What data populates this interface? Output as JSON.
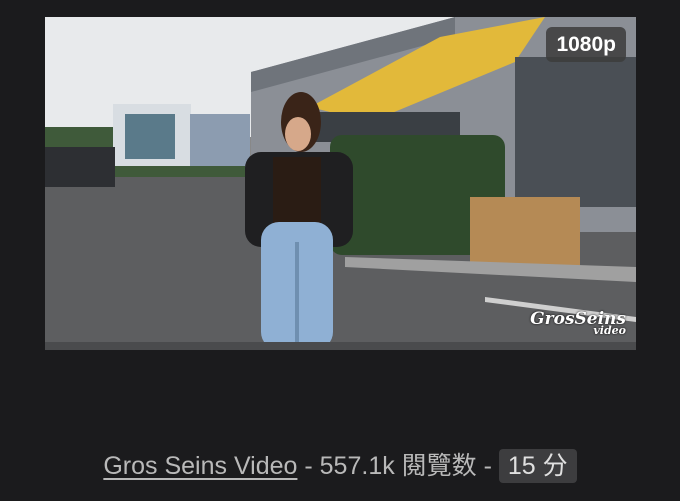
{
  "video": {
    "quality": "1080p",
    "watermark_line1": "GrosSeins",
    "watermark_line2": "video"
  },
  "meta": {
    "channel": "Gros Seins Video",
    "sep1": " - ",
    "views": "557.1k 閱覽数",
    "sep2": " - ",
    "duration": "15 分"
  },
  "icons": [
    "video-thumbnail"
  ]
}
